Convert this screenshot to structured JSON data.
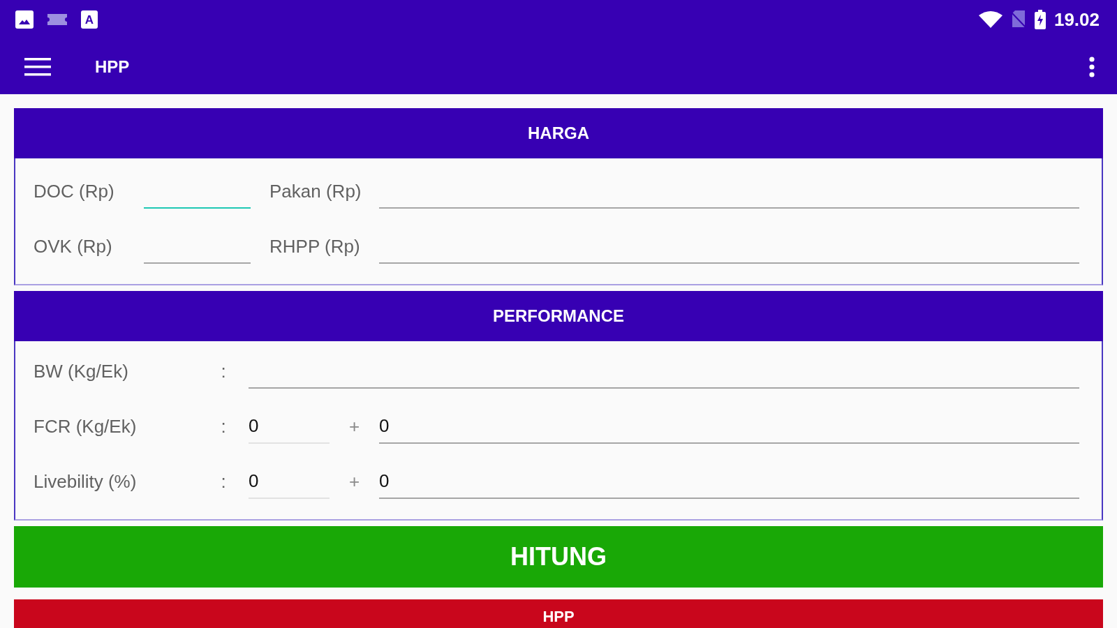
{
  "status_bar": {
    "notification_icons": [
      {
        "kind": "image"
      },
      {
        "kind": "card"
      },
      {
        "kind": "letter",
        "text": "A"
      }
    ],
    "time": "19.02"
  },
  "app_bar": {
    "title": "HPP"
  },
  "harga": {
    "title": "HARGA",
    "rows": [
      {
        "cells": [
          {
            "label": "DOC (Rp)",
            "focused": true
          },
          {
            "label": "Pakan (Rp)",
            "focused": false
          }
        ]
      },
      {
        "cells": [
          {
            "label": "OVK (Rp)",
            "focused": false
          },
          {
            "label": "RHPP (Rp)",
            "focused": false
          }
        ]
      }
    ]
  },
  "performance": {
    "title": "PERFORMANCE",
    "rows": [
      {
        "label": "BW (Kg/Ek)",
        "colon": ":",
        "fields": [
          {
            "focused": false
          }
        ]
      },
      {
        "label": "FCR (Kg/Ek)",
        "colon": ":",
        "plus": "+",
        "fields": [
          {
            "value": "0",
            "focused": false
          },
          {
            "value": "0",
            "focused": false
          }
        ]
      },
      {
        "label": "Livebility (%)",
        "colon": ":",
        "plus": "+",
        "fields": [
          {
            "value": "0",
            "focused": false
          },
          {
            "value": "0",
            "focused": false
          }
        ]
      }
    ]
  },
  "calculate_button": {
    "label": "HITUNG"
  },
  "result": {
    "title": "HPP"
  }
}
